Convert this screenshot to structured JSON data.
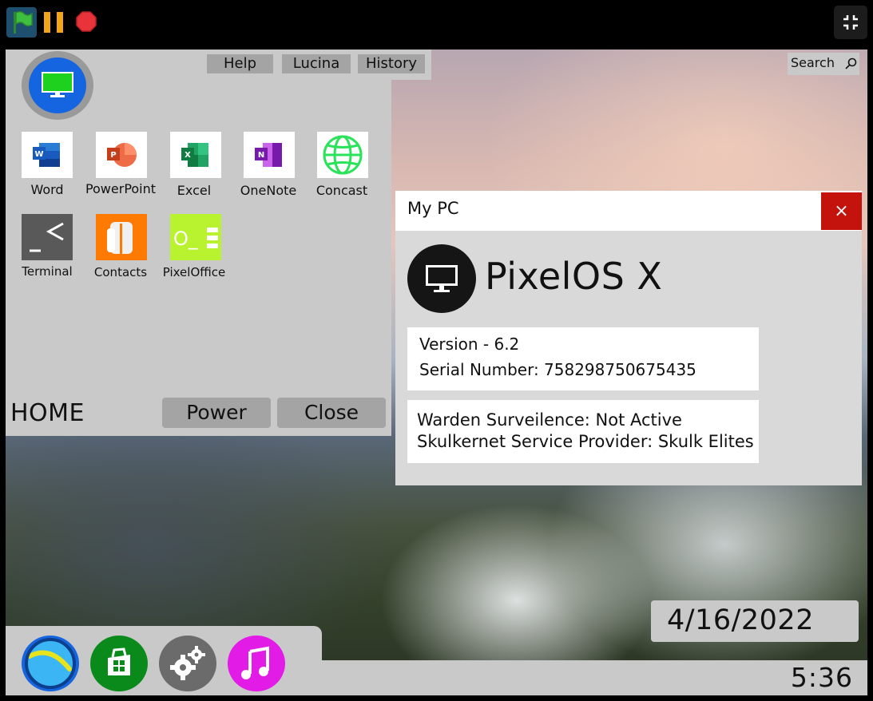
{
  "player": {
    "flag_icon": "green-flag-icon",
    "pause_icon": "pause-icon",
    "stop_icon": "stop-sign-icon",
    "fullscreen_icon": "exit-fullscreen-icon"
  },
  "home": {
    "tabs": [
      "Help",
      "Lucina",
      "History"
    ],
    "apps": [
      {
        "label": "Word",
        "icon": "word-icon"
      },
      {
        "label": "PowerPoint",
        "icon": "powerpoint-icon"
      },
      {
        "label": "Excel",
        "icon": "excel-icon"
      },
      {
        "label": "OneNote",
        "icon": "onenote-icon"
      },
      {
        "label": "Concast",
        "icon": "globe-icon"
      },
      {
        "label": "Terminal",
        "icon": "terminal-icon"
      },
      {
        "label": "Contacts",
        "icon": "contacts-icon"
      },
      {
        "label": "PixelOffice",
        "icon": "pixeloffice-icon"
      }
    ],
    "title": "HOME",
    "power_label": "Power",
    "close_label": "Close"
  },
  "search": {
    "label": "Search",
    "icon": "search-icon"
  },
  "window": {
    "title": "My PC",
    "close_symbol": "×",
    "os_name": "PixelOS X",
    "version": "Version - 6.2",
    "serial": "Serial Number: 758298750675435",
    "warden": "Warden Surveilence: Not Active",
    "provider": "Skulkernet Service Provider: Skulk Elites"
  },
  "date": "4/16/2022",
  "time": "5:36",
  "dock": [
    {
      "icon": "browser-icon",
      "color": "#1565e0"
    },
    {
      "icon": "store-icon",
      "color": "#0a8a1a"
    },
    {
      "icon": "settings-gears-icon",
      "color": "#6b6b6b"
    },
    {
      "icon": "music-icon",
      "color": "#e21be6"
    }
  ],
  "colors": {
    "panel": "#c9c9c9",
    "button": "#a4a4a4",
    "close_red": "#c4120d",
    "avatar_blue": "#1565e0"
  }
}
